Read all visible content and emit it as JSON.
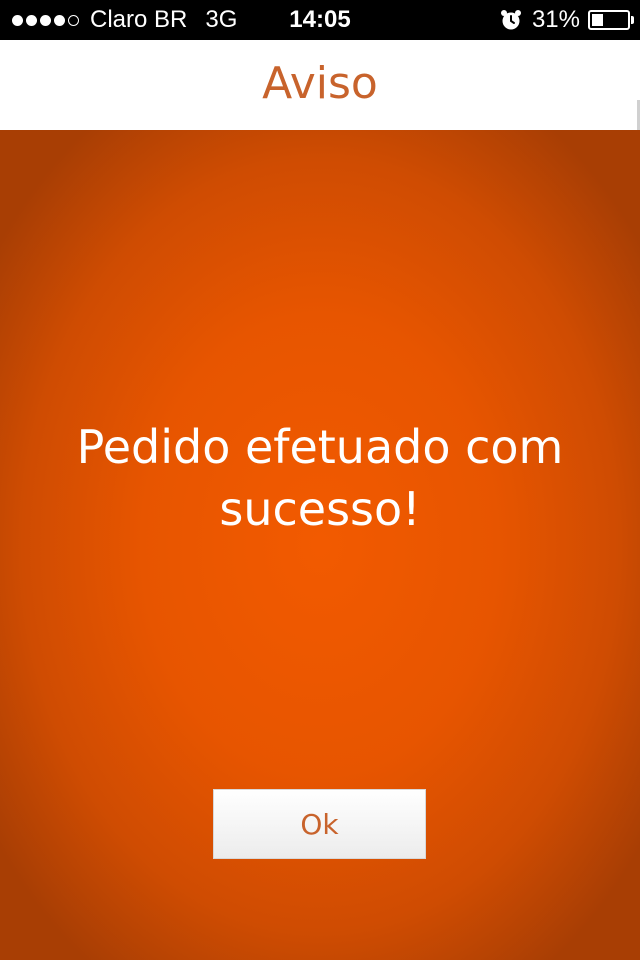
{
  "status_bar": {
    "signal_bars_filled": 4,
    "signal_bars_total": 5,
    "carrier": "Claro BR",
    "network": "3G",
    "time": "14:05",
    "alarm_icon": "alarm-clock-icon",
    "battery_percent_text": "31%",
    "battery_level": 0.31
  },
  "header": {
    "title": "Aviso"
  },
  "dialog": {
    "message": "Pedido efetuado com sucesso!",
    "ok_label": "Ok"
  },
  "colors": {
    "accent": "#c8632c",
    "background_center": "#f25a00",
    "background_edge": "#a83e04",
    "header_bg": "#ffffff",
    "status_bar_bg": "#000000"
  }
}
